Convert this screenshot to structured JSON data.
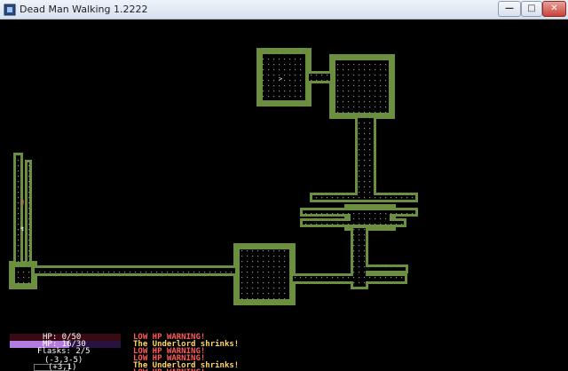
{
  "window": {
    "title": "Dead Man Walking 1.2222",
    "icon": "app-icon",
    "buttons": {
      "minimize": "—",
      "maximize": "□",
      "close": "✕"
    }
  },
  "colors": {
    "wall": "#6b8f3e",
    "floor_dot": "#8a8a8a",
    "background": "#000000",
    "hp_bar": "#3a0a14",
    "mp_bar": "#b47ce0",
    "mp_bar_bg": "#2a1240",
    "warning": "#ff5a5a",
    "event": "#ffd760",
    "player": "#ffffff",
    "monster": "#e06060"
  },
  "hud": {
    "hp": {
      "label": "HP: 0/50",
      "current": 0,
      "max": 50
    },
    "mp": {
      "label": "MP: 16/30",
      "current": 16,
      "max": 30
    },
    "flasks": {
      "label": "Flasks: 2/5"
    },
    "coords": "(-3,3-5)",
    "coords2": "(+3,1)"
  },
  "messages": [
    {
      "text": "LOW HP WARNING!",
      "type": "warning"
    },
    {
      "text": "The Underlord shrinks!",
      "type": "event"
    },
    {
      "text": "LOW HP WARNING!",
      "type": "warning"
    },
    {
      "text": "LOW HP WARNING!",
      "type": "warning"
    },
    {
      "text": "The Underlord shrinks!",
      "type": "event"
    },
    {
      "text": "LOW HP WARNING!",
      "type": "warning"
    }
  ],
  "map": {
    "glyphs": {
      "monster": "@",
      "item": "↯",
      "arrow": ">"
    }
  }
}
